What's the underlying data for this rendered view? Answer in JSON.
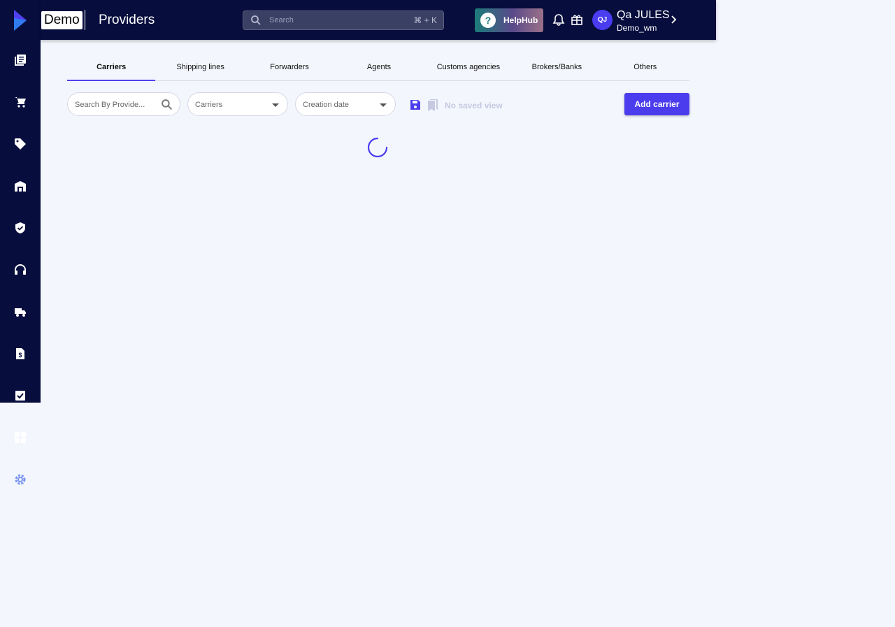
{
  "header": {
    "brand": "Demo",
    "page_title": "Providers",
    "search_placeholder": "Search",
    "search_shortcut": "⌘ + K",
    "helphub_label": "HelpHub",
    "user": {
      "initials": "QJ",
      "name": "Qa JULES",
      "org": "Demo_wm"
    }
  },
  "tabs": [
    {
      "label": "Carriers",
      "active": true
    },
    {
      "label": "Shipping lines"
    },
    {
      "label": "Forwarders"
    },
    {
      "label": "Agents"
    },
    {
      "label": "Customs agencies"
    },
    {
      "label": "Brokers/Banks"
    },
    {
      "label": "Others"
    }
  ],
  "filters": {
    "search_placeholder": "Search By Provide...",
    "type_select": "Carriers",
    "date_select": "Creation date",
    "saved_view": "No saved view",
    "add_button": "Add carrier"
  },
  "sidebar": {
    "items": [
      "orders-icon",
      "cart-icon",
      "tag-icon",
      "warehouse-icon",
      "shield-check-icon",
      "headset-icon",
      "truck-icon",
      "invoice-icon",
      "checkbox-icon",
      "grid-icon",
      "settings-icon"
    ]
  },
  "colors": {
    "nav_bg": "#070d3d",
    "accent": "#4b3ded",
    "page_bg": "#f3f6fd"
  }
}
